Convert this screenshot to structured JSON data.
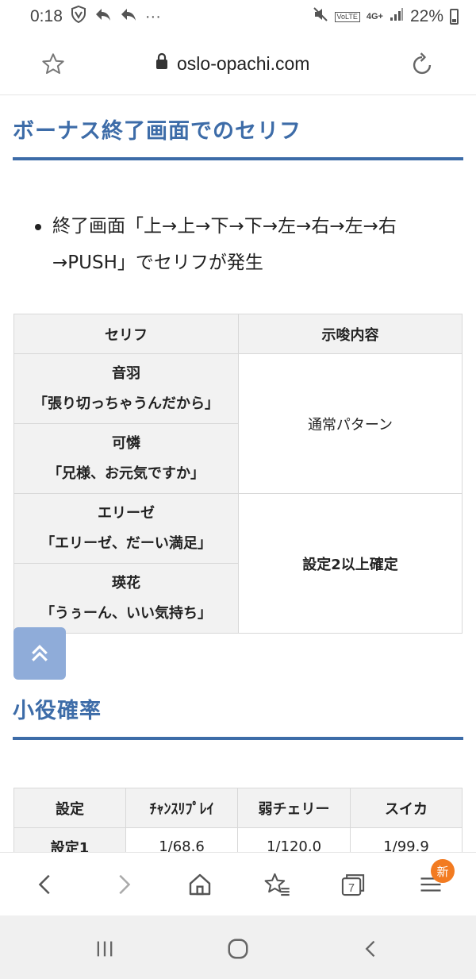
{
  "status_bar": {
    "time": "0:18",
    "icons_left": [
      "shield-icon",
      "reply-icon",
      "reply-icon",
      "more-icon"
    ],
    "more": "···",
    "volte": "VoLTE",
    "network": "4G+",
    "battery": "22%"
  },
  "address_bar": {
    "url": "oslo-opachi.com"
  },
  "section1": {
    "heading": "ボーナス終了画面でのセリフ",
    "bullet": "終了画面「上→上→下→下→左→右→左→右→PUSH」でセリフが発生"
  },
  "serif_table": {
    "headers": [
      "セリフ",
      "示唆内容"
    ],
    "rows": [
      {
        "name": "音羽",
        "line": "「張り切っちゃうんだから」"
      },
      {
        "name": "可憐",
        "line": "「兄様、お元気ですか」"
      },
      {
        "name": "エリーゼ",
        "line": "「エリーゼ、だーい満足」"
      },
      {
        "name": "瑛花",
        "line": "「うぅーん、いい気持ち」"
      }
    ],
    "meanings": [
      "通常パターン",
      "設定2以上確定"
    ]
  },
  "section2": {
    "heading": "小役確率"
  },
  "prob_table": {
    "headers": [
      "設定",
      "ﾁｬﾝｽﾘﾌﾟﾚｲ",
      "弱チェリー",
      "スイカ"
    ],
    "rows": [
      [
        "設定1",
        "1/68.6",
        "1/120.0",
        "1/99.9"
      ]
    ]
  },
  "toolbar": {
    "badge": "新",
    "tabs_count": "7"
  },
  "colors": {
    "accent": "#3d6ca8",
    "to_top": "#8facd9",
    "badge": "#f27b21"
  }
}
